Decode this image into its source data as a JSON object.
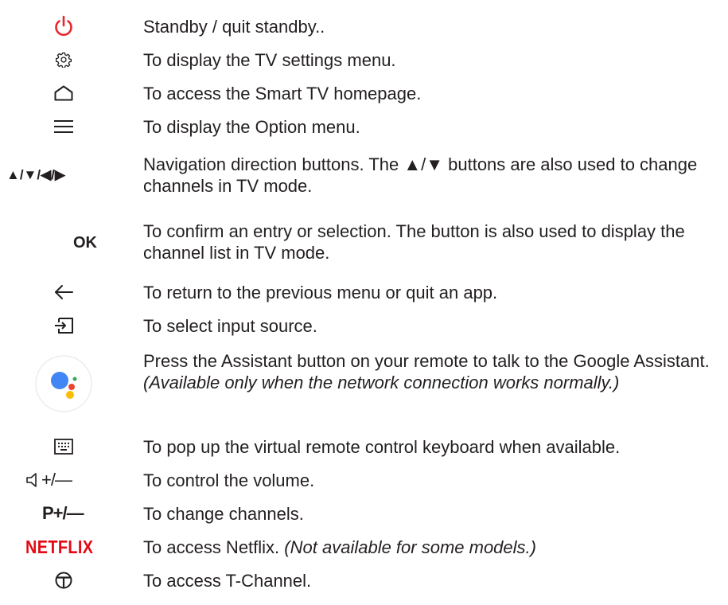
{
  "rows": [
    {
      "icon": "power-icon",
      "text": "Standby / quit standby.."
    },
    {
      "icon": "gear-icon",
      "text": "To display the TV settings menu."
    },
    {
      "icon": "home-icon",
      "text": "To access the Smart TV homepage."
    },
    {
      "icon": "menu-icon",
      "text": "To display the Option menu."
    },
    {
      "icon": "arrows-icon",
      "label": "▲/▼/◀/▶",
      "text": "Navigation direction buttons. The ▲/▼ buttons are also used to change channels in TV mode."
    },
    {
      "icon": "ok-icon",
      "label": "OK",
      "text": "To confirm an entry or selection. The button is also used to display the channel list in TV mode."
    },
    {
      "icon": "back-arrow-icon",
      "text": "To return to the previous menu or quit an app."
    },
    {
      "icon": "input-source-icon",
      "text": "To select input source."
    },
    {
      "icon": "google-assistant-icon",
      "text": "Press the Assistant button on your remote to talk to the Google Assistant.",
      "note": "(Available only when the network connection works normally.)"
    },
    {
      "icon": "keyboard-icon",
      "text": "To pop up the virtual remote control keyboard when available."
    },
    {
      "icon": "volume-icon",
      "label": "+/—",
      "text": "To control the volume."
    },
    {
      "icon": "channel-icon",
      "label": "P+/—",
      "text": "To change channels."
    },
    {
      "icon": "netflix-icon",
      "label": "NETFLIX",
      "text": "To access Netflix.",
      "note": "(Not available for some models.)"
    },
    {
      "icon": "t-channel-icon",
      "text": "To access T-Channel."
    }
  ],
  "colors": {
    "text": "#231f20",
    "power": "#e8262d",
    "netflix": "#e50914",
    "assistant_blue": "#4285f4",
    "assistant_red": "#ea4335",
    "assistant_yellow": "#fbbc05",
    "assistant_green": "#34a853"
  }
}
